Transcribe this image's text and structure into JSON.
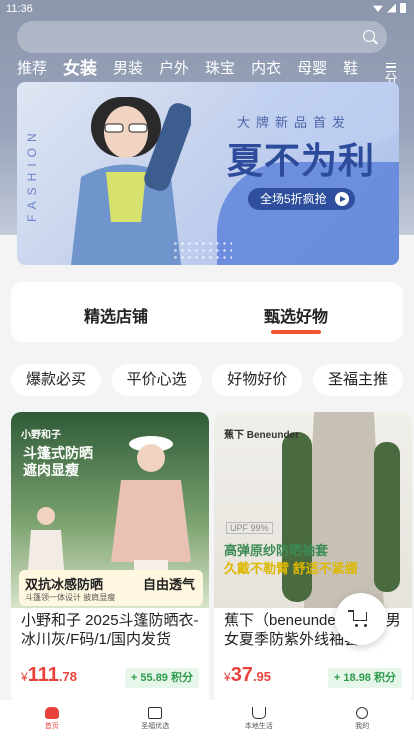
{
  "status_bar": {
    "time": "11:36"
  },
  "search": {
    "placeholder": ""
  },
  "categories": [
    {
      "label": "推荐",
      "active": false
    },
    {
      "label": "女装",
      "active": true
    },
    {
      "label": "男装",
      "active": false
    },
    {
      "label": "户外",
      "active": false
    },
    {
      "label": "珠宝",
      "active": false
    },
    {
      "label": "内衣",
      "active": false
    },
    {
      "label": "母婴",
      "active": false
    },
    {
      "label": "鞋",
      "active": false
    }
  ],
  "menu": {
    "label": "分类"
  },
  "banner": {
    "vertical_text": "FASHION",
    "subtitle": "大牌新品首发",
    "headline": "夏不为利",
    "button": "全场5折疯抢"
  },
  "tabs": {
    "tab1": "精选店铺",
    "tab2": "甄选好物",
    "active": "tab2"
  },
  "chips": [
    "爆款必买",
    "平价心选",
    "好物好价",
    "圣福主推"
  ],
  "products": [
    {
      "brand": "小野和子",
      "image_headline_1": "斗篷式防晒",
      "image_headline_2": "遮肉显瘦",
      "band_left": "双抗冰感防晒",
      "band_right": "自由透气",
      "band_small": "斗篷领一体设计 披肩显瘦",
      "title": "小野和子 2025斗篷防晒衣-冰川灰/F码/1/国内发货",
      "price_currency": "¥",
      "price_int": "111",
      "price_dec": ".78",
      "points": "+ 55.89 积分"
    },
    {
      "brand": "蕉下 Beneunder",
      "image_tag": "UPF 99%",
      "image_headline_1": "高弹原纱防晒袖套",
      "image_headline_2": "久戴不勒臂 舒适不紧绷",
      "title": "蕉下（beneunder）冰袖男女夏季防紫外线袖套",
      "price_currency": "¥",
      "price_int": "37",
      "price_dec": ".95",
      "points": "+ 18.98 积分"
    }
  ],
  "bottom_nav": [
    {
      "label": "首页",
      "icon": "home-icon",
      "active": true
    },
    {
      "label": "圣福优选",
      "icon": "store-icon",
      "active": false
    },
    {
      "label": "本地生活",
      "icon": "cup-icon",
      "active": false
    },
    {
      "label": "我的",
      "icon": "profile-icon",
      "active": false
    }
  ],
  "colors": {
    "accent": "#e8423a",
    "points_green": "#2e9b4a",
    "tab_underline": "#ee5533"
  }
}
